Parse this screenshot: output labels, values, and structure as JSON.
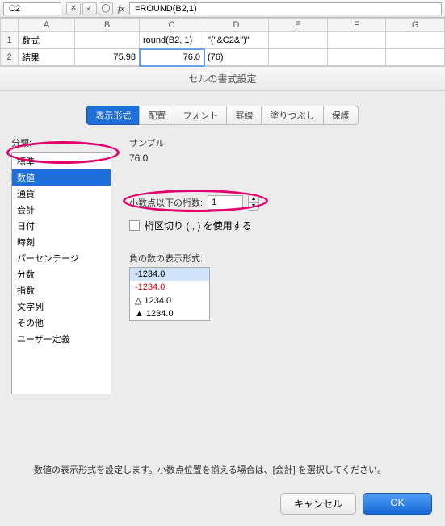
{
  "formula_bar": {
    "cell_ref": "C2",
    "fx": "=ROUND(B2,1)"
  },
  "sheet": {
    "cols": [
      "A",
      "B",
      "C",
      "D",
      "E",
      "F",
      "G"
    ],
    "rows": [
      {
        "n": "1",
        "cells": [
          "数式",
          "",
          "round(B2, 1)",
          "\"(\"&C2&\")\"",
          "",
          "",
          ""
        ]
      },
      {
        "n": "2",
        "cells": [
          "結果",
          "75.98",
          "76.0",
          "(76)",
          "",
          "",
          ""
        ]
      }
    ]
  },
  "dialog": {
    "title": "セルの書式設定",
    "tabs": [
      "表示形式",
      "配置",
      "フォント",
      "罫線",
      "塗りつぶし",
      "保護"
    ],
    "category_label": "分類:",
    "categories": [
      "標準",
      "数値",
      "通貨",
      "会計",
      "日付",
      "時刻",
      "パーセンテージ",
      "分数",
      "指数",
      "文字列",
      "その他",
      "ユーザー定義"
    ],
    "selected_category_index": 1,
    "sample_label": "サンプル",
    "sample_value": "76.0",
    "decimal_label": "小数点以下の桁数:",
    "decimal_value": "1",
    "thousands_label": "桁区切り ( , ) を使用する",
    "neg_label": "負の数の表示形式:",
    "neg_items": [
      "-1234.0",
      "-1234.0",
      "△ 1234.0",
      "▲ 1234.0"
    ],
    "help_text": "数値の表示形式を設定します。小数点位置を揃える場合は、[会計] を選択してください。",
    "buttons": {
      "cancel": "キャンセル",
      "ok": "OK"
    }
  }
}
